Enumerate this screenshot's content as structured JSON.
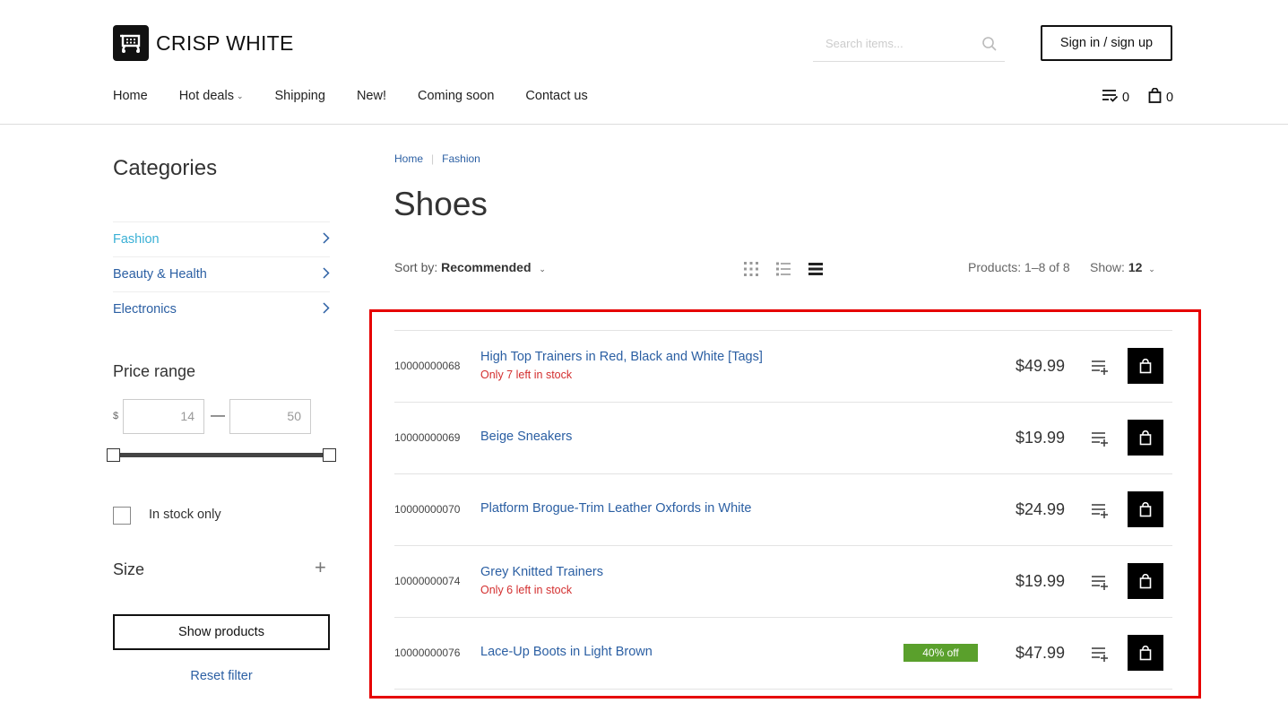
{
  "brand": {
    "name": "CRISP WHITE"
  },
  "header": {
    "search_placeholder": "Search items...",
    "signin_label": "Sign in / sign up",
    "nav": [
      "Home",
      "Hot deals",
      "Shipping",
      "New!",
      "Coming soon",
      "Contact us"
    ],
    "wishlist_count": "0",
    "cart_count": "0"
  },
  "sidebar": {
    "categories_title": "Categories",
    "categories": [
      "Fashion",
      "Beauty & Health",
      "Electronics"
    ],
    "price_title": "Price range",
    "currency": "$",
    "price_min": "14",
    "price_max": "50",
    "price_separator": "—",
    "in_stock_label": "In stock only",
    "size_title": "Size",
    "size_expand": "+",
    "show_products_label": "Show products",
    "reset_label": "Reset filter"
  },
  "breadcrumb": [
    "Home",
    "Fashion"
  ],
  "page_title": "Shoes",
  "toolbar": {
    "sort_prefix": "Sort by:",
    "sort_value": "Recommended",
    "products_count": "Products: 1–8 of 8",
    "show_prefix": "Show:",
    "show_value": "12"
  },
  "products": [
    {
      "sku": "10000000068",
      "name": "High Top Trainers in Red, Black and White [Tags]",
      "stock_note": "Only 7 left in stock",
      "badge": "",
      "price": "$49.99"
    },
    {
      "sku": "10000000069",
      "name": "Beige Sneakers",
      "stock_note": "",
      "badge": "",
      "price": "$19.99"
    },
    {
      "sku": "10000000070",
      "name": "Platform Brogue-Trim Leather Oxfords in White",
      "stock_note": "",
      "badge": "",
      "price": "$24.99"
    },
    {
      "sku": "10000000074",
      "name": "Grey Knitted Trainers",
      "stock_note": "Only 6 left in stock",
      "badge": "",
      "price": "$19.99"
    },
    {
      "sku": "10000000076",
      "name": "Lace-Up Boots in Light Brown",
      "stock_note": "",
      "badge": "40% off",
      "price": "$47.99"
    }
  ],
  "colors": {
    "link": "#2b5fa3",
    "active_category": "#3ab0d5",
    "stock_warning": "#d32f2f",
    "badge": "#5aa02c",
    "highlight": "#e60000"
  }
}
